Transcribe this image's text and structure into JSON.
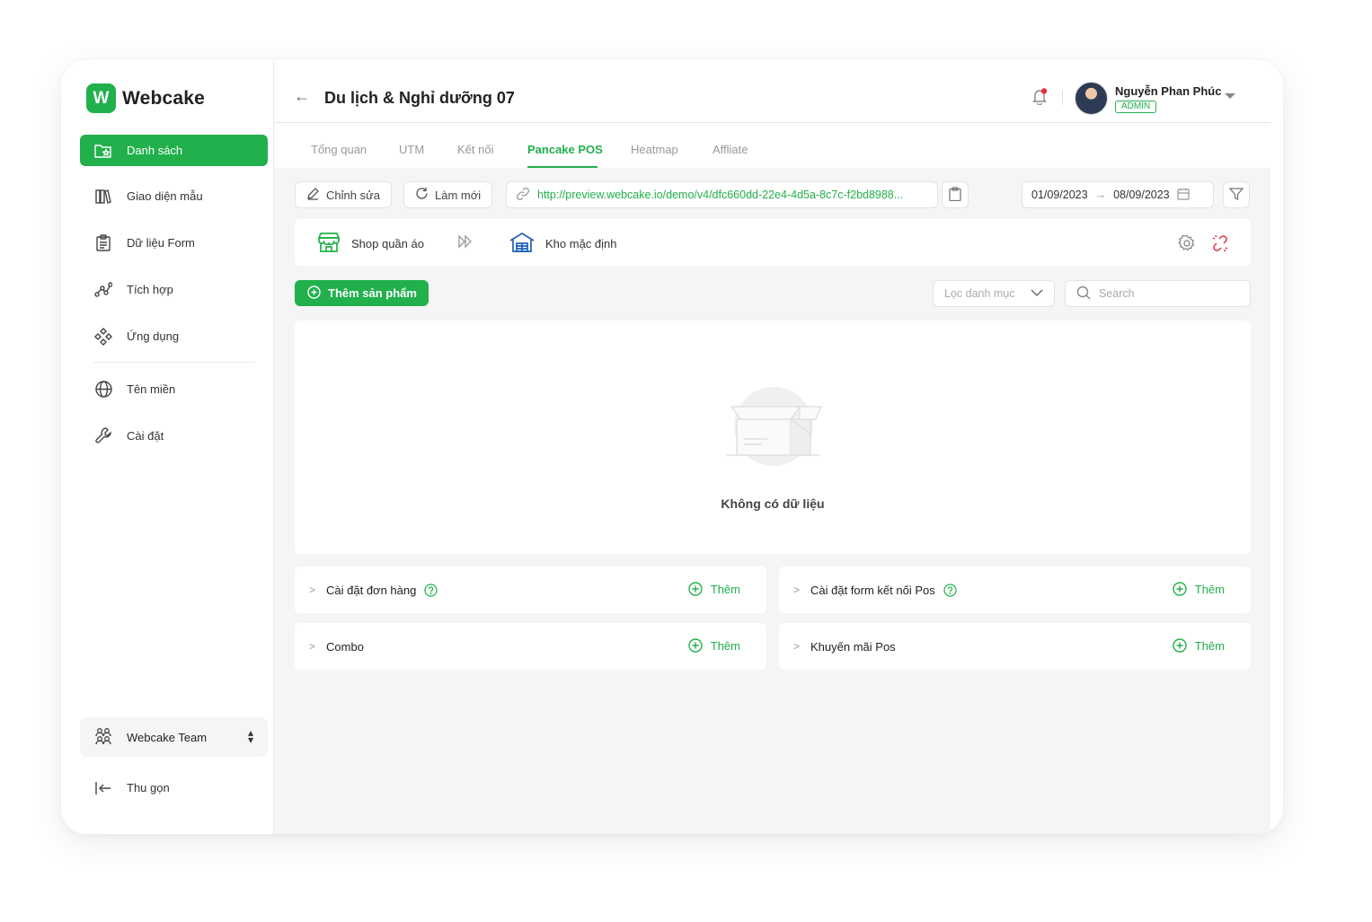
{
  "app": {
    "logo_letter": "W",
    "name": "Webcake"
  },
  "sidebar": {
    "items": [
      {
        "label": "Danh sách",
        "icon": "folder-star-icon",
        "active": true
      },
      {
        "label": "Giao diện mẫu",
        "icon": "books-icon"
      },
      {
        "label": "Dữ liệu Form",
        "icon": "clipboard-icon"
      },
      {
        "label": "Tích hợp",
        "icon": "integration-icon"
      },
      {
        "label": "Ứng dụng",
        "icon": "apps-icon"
      },
      {
        "label": "Tên miền",
        "icon": "globe-icon"
      },
      {
        "label": "Cài đặt",
        "icon": "wrench-icon"
      }
    ],
    "team": {
      "label": "Webcake Team",
      "icon": "team-icon"
    },
    "collapse": {
      "label": "Thu gọn",
      "icon": "collapse-icon"
    }
  },
  "header": {
    "title": "Du lịch & Nghỉ dưỡng 07",
    "user": {
      "name": "Nguyễn Phan Phúc",
      "role": "ADMIN"
    }
  },
  "tabs": [
    {
      "label": "Tổng quan"
    },
    {
      "label": "UTM"
    },
    {
      "label": "Kết nối"
    },
    {
      "label": "Pancake POS",
      "active": true
    },
    {
      "label": "Heatmap"
    },
    {
      "label": "Affliate"
    }
  ],
  "toolbar": {
    "edit_label": "Chỉnh sửa",
    "refresh_label": "Làm mới",
    "url": "http://preview.webcake.io/demo/v4/dfc660dd-22e4-4d5a-8c7c-f2bd8988...",
    "date_from": "01/09/2023",
    "date_to": "08/09/2023"
  },
  "connection": {
    "shop": "Shop quần áo",
    "warehouse": "Kho mặc định"
  },
  "products": {
    "add_label": "Thêm sản phẩm",
    "category_filter": "Lọc danh mục",
    "search_placeholder": "Search",
    "empty_text": "Không có dữ liệu"
  },
  "sections": [
    {
      "title": "Cài đặt đơn hàng",
      "has_help": true,
      "add_label": "Thêm"
    },
    {
      "title": "Cài đặt form kết nối Pos",
      "has_help": true,
      "add_label": "Thêm"
    },
    {
      "title": "Combo",
      "has_help": false,
      "add_label": "Thêm"
    },
    {
      "title": "Khuyến mãi Pos",
      "has_help": false,
      "add_label": "Thêm"
    }
  ],
  "colors": {
    "accent": "#21b04b",
    "danger": "#e5303c",
    "warehouse_blue": "#1f5fb8"
  }
}
